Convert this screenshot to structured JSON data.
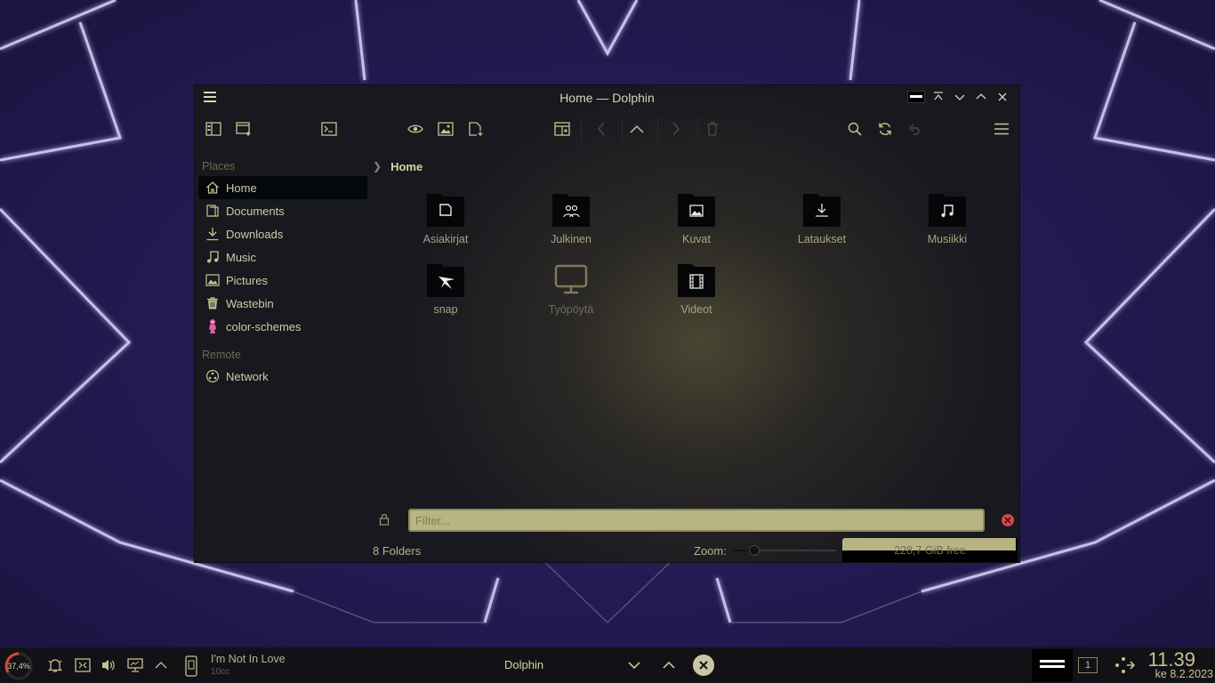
{
  "window": {
    "title": "Home — Dolphin"
  },
  "sidebar": {
    "places_label": "Places",
    "places": [
      {
        "label": "Home",
        "icon": "home-icon",
        "active": true
      },
      {
        "label": "Documents",
        "icon": "document-icon"
      },
      {
        "label": "Downloads",
        "icon": "download-icon"
      },
      {
        "label": "Music",
        "icon": "music-icon"
      },
      {
        "label": "Pictures",
        "icon": "picture-icon"
      },
      {
        "label": "Wastebin",
        "icon": "trash-icon"
      },
      {
        "label": "color-schemes",
        "icon": "pink-panther-icon"
      }
    ],
    "remote_label": "Remote",
    "remote": [
      {
        "label": "Network",
        "icon": "network-icon"
      }
    ]
  },
  "breadcrumb": {
    "current": "Home"
  },
  "items": [
    {
      "label": "Asiakirjat",
      "icon": "document-folder-icon"
    },
    {
      "label": "Julkinen",
      "icon": "public-folder-icon"
    },
    {
      "label": "Kuvat",
      "icon": "pictures-folder-icon"
    },
    {
      "label": "Lataukset",
      "icon": "downloads-folder-icon"
    },
    {
      "label": "Musiikki",
      "icon": "music-folder-icon"
    },
    {
      "label": "snap",
      "icon": "snap-folder-icon"
    },
    {
      "label": "Työpöytä",
      "icon": "desktop-icon"
    },
    {
      "label": "Videot",
      "icon": "videos-folder-icon"
    }
  ],
  "filter": {
    "placeholder": "Filter..."
  },
  "status": {
    "summary": "8 Folders",
    "zoom_label": "Zoom:",
    "zoom_level": 0.22,
    "free_space": "228,7 GiB free",
    "used_fraction": 0.99
  },
  "taskbar": {
    "cpu": "37,4%",
    "media_title": "I'm Not In Love",
    "media_artist": "10cc",
    "task_title": "Dolphin",
    "pager_number": "1",
    "time": "11.39",
    "date": "ke 8.2.2023"
  },
  "colors": {
    "accent": "#b9b582",
    "close": "#d8454c",
    "taskbar": "#121116"
  }
}
